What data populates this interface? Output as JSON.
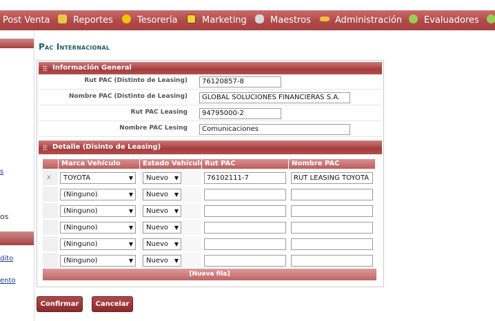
{
  "menu": {
    "items": [
      {
        "label": "Post Venta",
        "icon": "none"
      },
      {
        "label": "Reportes",
        "icon": "report-icon"
      },
      {
        "label": "Tesorería",
        "icon": "coin-icon"
      },
      {
        "label": "Marketing",
        "icon": "monitor-icon"
      },
      {
        "label": "Maestros",
        "icon": "database-icon"
      },
      {
        "label": "Administración",
        "icon": "key-icon"
      },
      {
        "label": "Evaluadores",
        "icon": "check-icon"
      }
    ]
  },
  "left": {
    "frag_s": "s",
    "frag_os": "os",
    "frag_dito": "dito",
    "frag_ento": "ento"
  },
  "page": {
    "title": "Pac Internacional"
  },
  "info": {
    "header": "Información General",
    "fields": [
      {
        "label": "Rut PAC (Distinto de Leasing)",
        "value": "76120857-8"
      },
      {
        "label": "Nombre PAC (Distinto de Leasing)",
        "value": "GLOBAL SOLUCIONES FINANCIERAS S.A."
      },
      {
        "label": "Rut PAC Leasing",
        "value": "94795000-2"
      },
      {
        "label": "Nombre PAC Lesing",
        "value": "Comunicaciones"
      }
    ]
  },
  "detail": {
    "header": "Detalle (Disinto de Leasing)",
    "columns": [
      "Marca Vehículo",
      "Estado Vehículo",
      "Rut PAC",
      "Nombre PAC"
    ],
    "rows": [
      {
        "marca": "TOYOTA",
        "estado": "Nuevo",
        "rut": "76102111-7",
        "nombre": "RUT LEASING TOYOTA",
        "delete": "x"
      },
      {
        "marca": "(Ninguno)",
        "estado": "Nuevo",
        "rut": "",
        "nombre": "",
        "delete": ""
      },
      {
        "marca": "(Ninguno)",
        "estado": "Nuevo",
        "rut": "",
        "nombre": "",
        "delete": ""
      },
      {
        "marca": "(Ninguno)",
        "estado": "Nuevo",
        "rut": "",
        "nombre": "",
        "delete": ""
      },
      {
        "marca": "(Ninguno)",
        "estado": "Nuevo",
        "rut": "",
        "nombre": "",
        "delete": ""
      },
      {
        "marca": "(Ninguno)",
        "estado": "Nuevo",
        "rut": "",
        "nombre": "",
        "delete": ""
      }
    ],
    "new_row_label": "[Nueva fila]",
    "dropdown_arrow": "▼"
  },
  "actions": {
    "confirm": "Confirmar",
    "cancel": "Cancelar"
  },
  "colors": {
    "menu": "#b04a4a",
    "header": "#a63d3d",
    "title": "#1e5a66",
    "button": "#8c2a2a"
  }
}
